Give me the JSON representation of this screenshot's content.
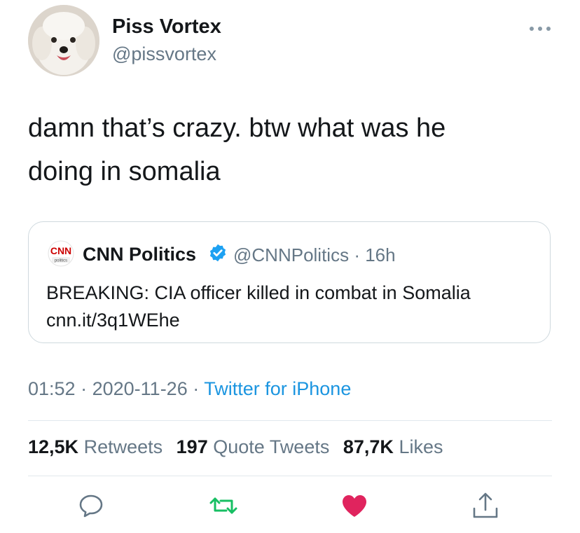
{
  "author": {
    "name": "Piss Vortex",
    "handle": "@pissvortex"
  },
  "tweet": {
    "text_line1": "damn that’s crazy. btw what was he",
    "text_line2": "doing in somalia"
  },
  "quote": {
    "logo_text": "CNN",
    "logo_sub": "politics",
    "name": "CNN Politics",
    "handle": "@CNNPolitics",
    "separator": "·",
    "time": "16h",
    "text": "BREAKING: CIA officer killed in combat in Somalia",
    "link": "cnn.it/3q1WEhe"
  },
  "meta": {
    "time": "01:52",
    "date": "2020-11-26",
    "separator": "·",
    "source": "Twitter for iPhone"
  },
  "stats": {
    "retweets_count": "12,5K",
    "retweets_label": "Retweets",
    "quotes_count": "197",
    "quotes_label": "Quote Tweets",
    "likes_count": "87,7K",
    "likes_label": "Likes"
  },
  "actions": [
    "reply-icon",
    "retweet-icon",
    "like-icon",
    "share-icon"
  ],
  "colors": {
    "text": "#14171a",
    "secondary": "#657786",
    "link": "#1b95e0",
    "retweet": "#17bf63",
    "like": "#e0245e",
    "verified": "#1da1f2",
    "cnn": "#cc0000"
  }
}
